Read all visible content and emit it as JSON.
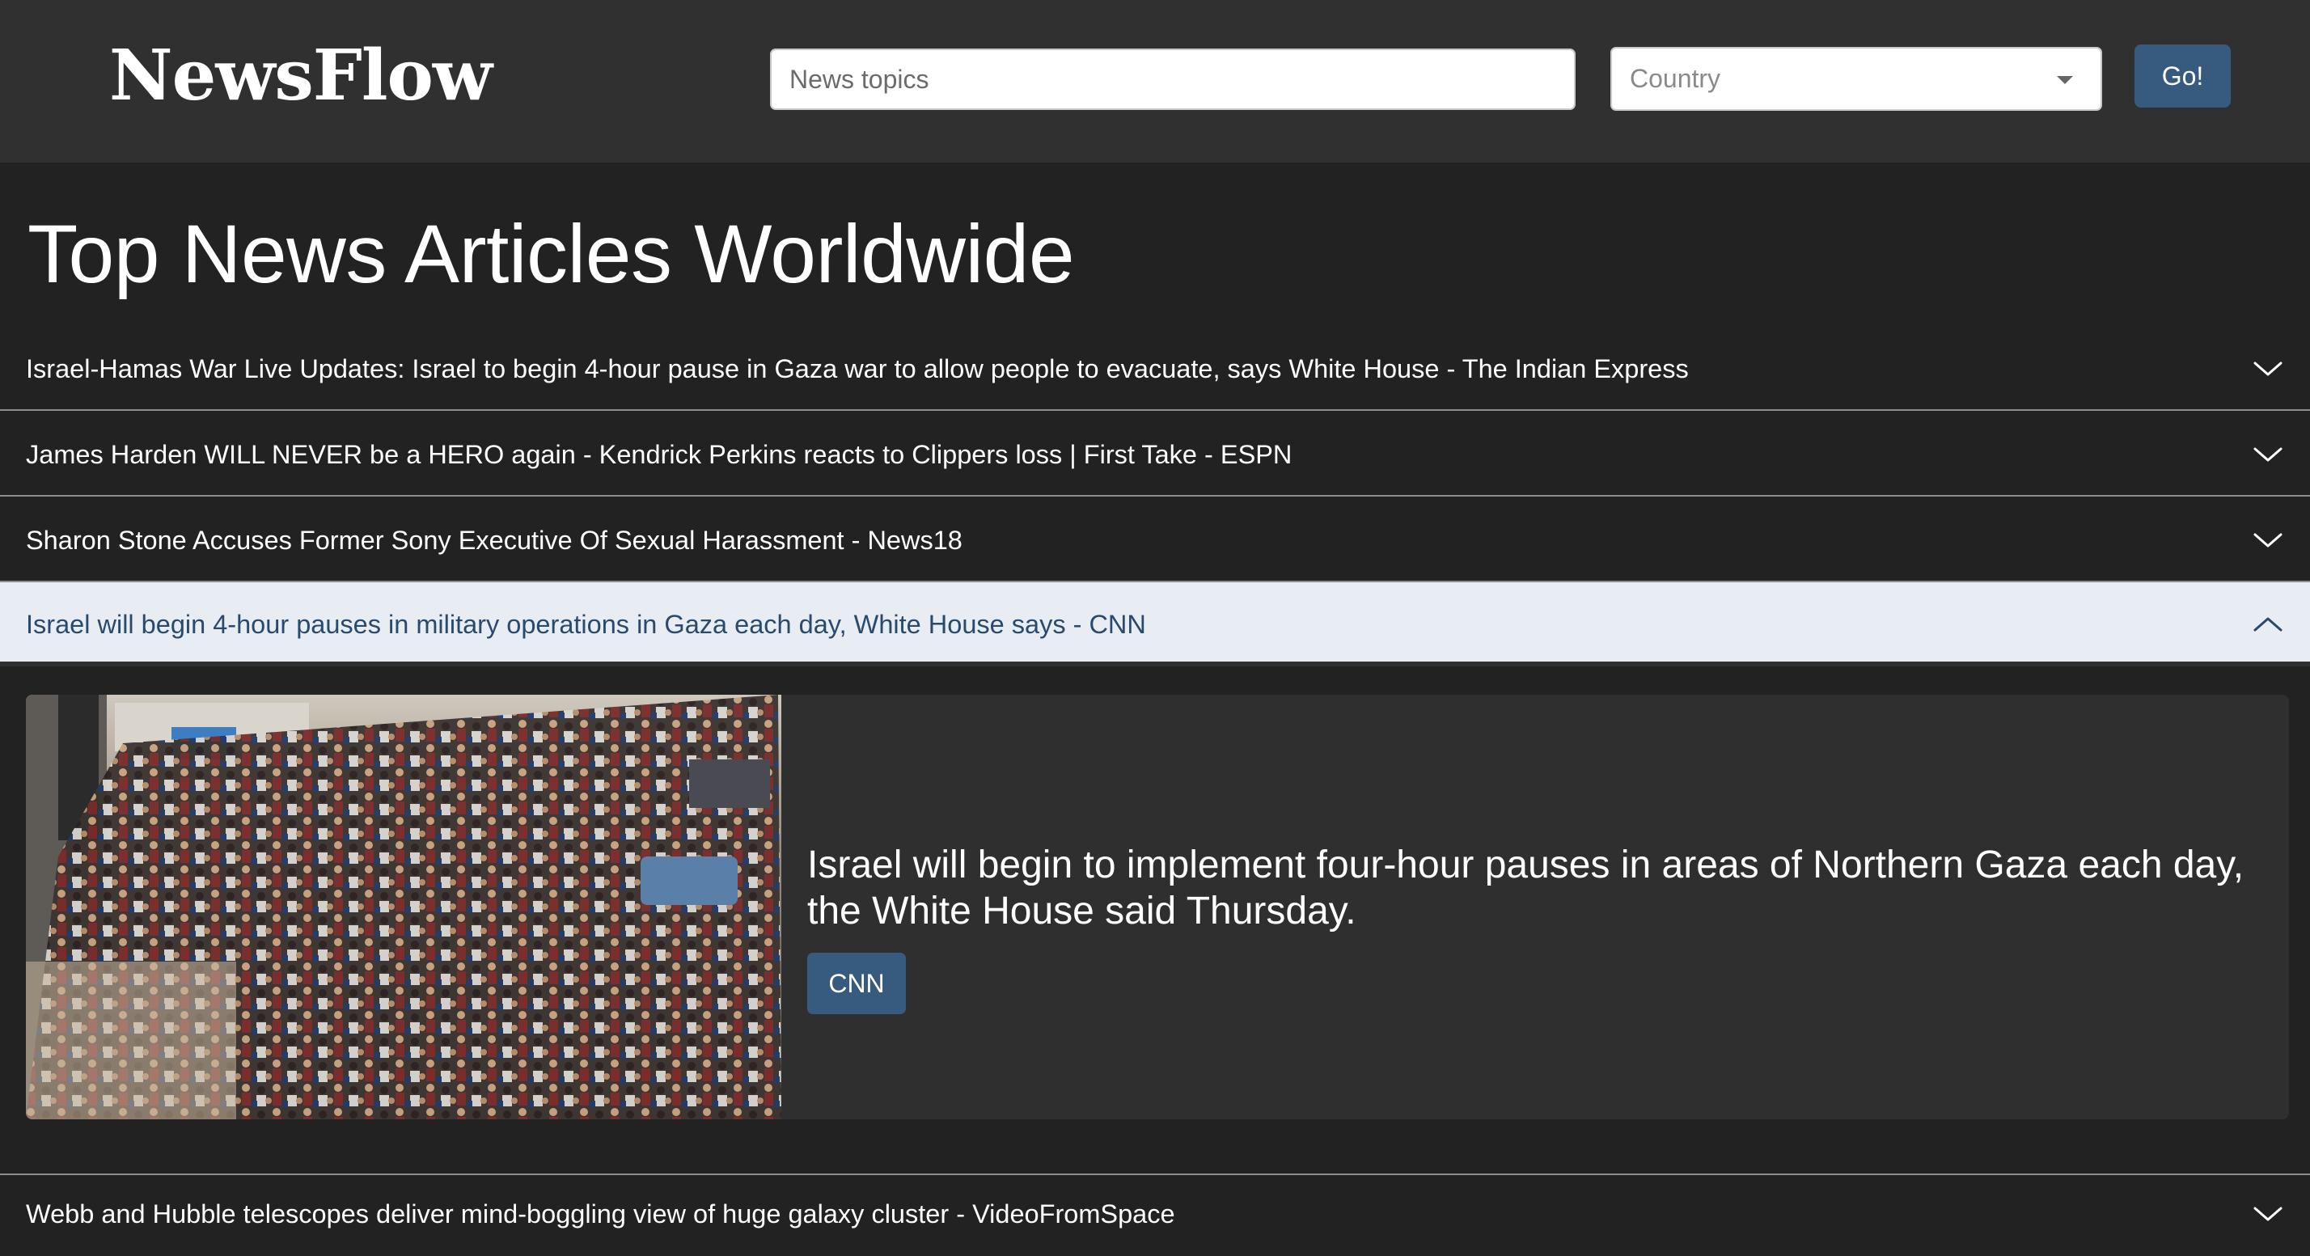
{
  "header": {
    "brand": "NewsFlow",
    "search_placeholder": "News topics",
    "country_placeholder": "Country",
    "go_label": "Go!"
  },
  "main": {
    "title": "Top News Articles Worldwide",
    "articles": [
      {
        "headline": "Israel-Hamas War Live Updates: Israel to begin 4-hour pause in Gaza war to allow people to evacuate, says White House - The Indian Express",
        "expanded": false
      },
      {
        "headline": "James Harden WILL NEVER be a HERO again - Kendrick Perkins reacts to Clippers loss | First Take - ESPN",
        "expanded": false
      },
      {
        "headline": "Sharon Stone Accuses Former Sony Executive Of Sexual Harassment - News18",
        "expanded": false
      },
      {
        "headline": "Israel will begin 4-hour pauses in military operations in Gaza each day, White House says - CNN",
        "expanded": true,
        "summary": "Israel will begin to implement four-hour pauses in areas of Northern Gaza each day, the White House said Thursday.",
        "source_label": "CNN"
      },
      {
        "headline": "Webb and Hubble telescopes deliver mind-boggling view of huge galaxy cluster - VideoFromSpace",
        "expanded": false
      }
    ]
  },
  "colors": {
    "header_bg": "#303030",
    "page_bg": "#222222",
    "accent": "#375a7f",
    "expanded_row_bg": "#e8edf3",
    "expanded_row_text": "#2a4a6b"
  },
  "icons": {
    "collapsed": "chevron-down-icon",
    "expanded": "chevron-up-icon",
    "select_caret": "caret-down-icon"
  }
}
